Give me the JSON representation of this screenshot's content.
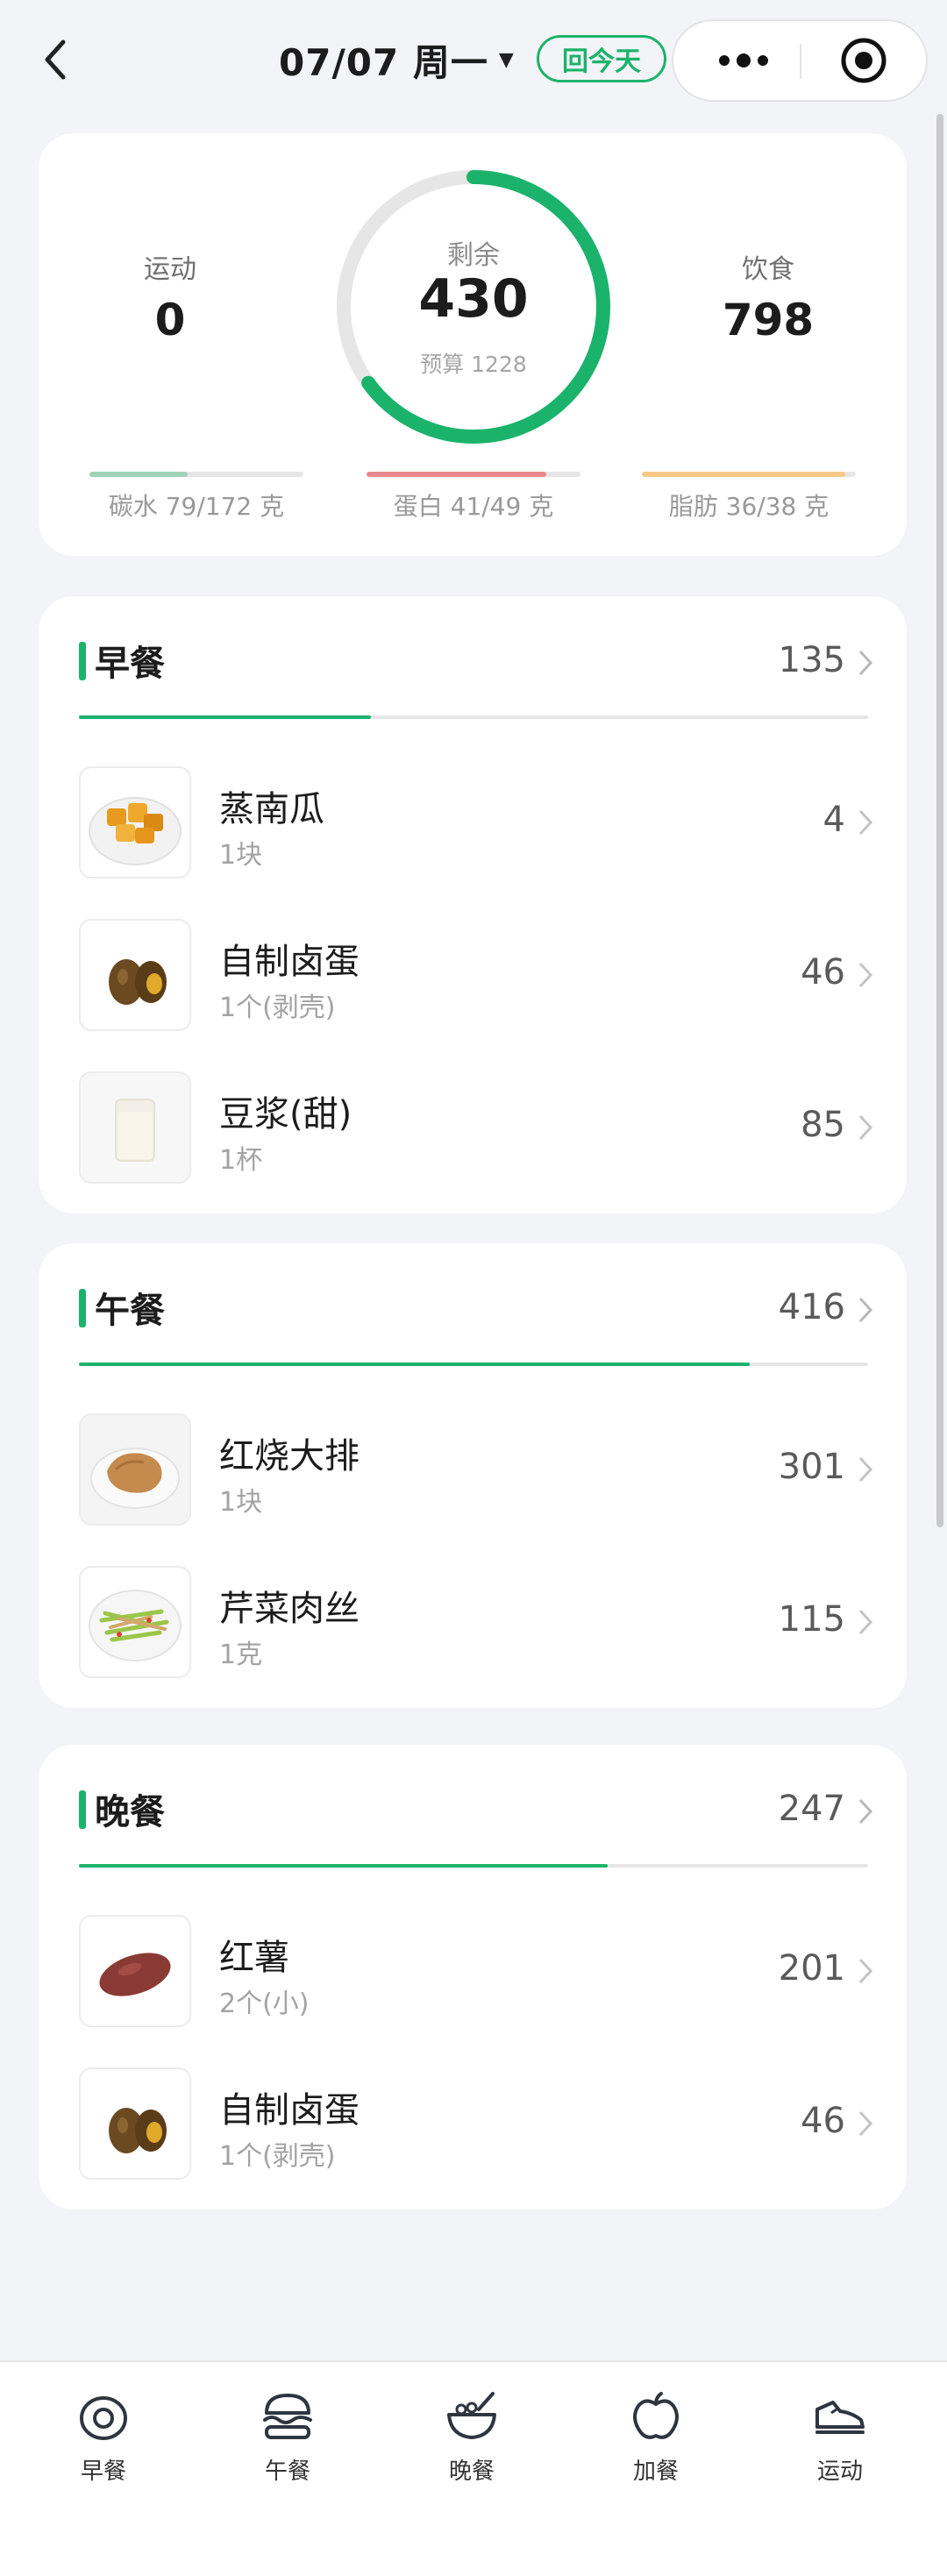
{
  "header": {
    "date": "07/07 周一",
    "dropdown_arrow": "▼",
    "today_badge": "回今天",
    "icons": {
      "back": "chevron-left-icon",
      "more": "more-dots-icon",
      "close": "target-close-icon"
    }
  },
  "summary": {
    "exercise": {
      "label": "运动",
      "value": "0"
    },
    "remaining": {
      "label": "剩余",
      "value": "430",
      "budget": "预算 1228",
      "ring_fraction": 0.65
    },
    "intake": {
      "label": "饮食",
      "value": "798"
    },
    "macros": [
      {
        "label": "碳水 79/172 克",
        "fraction": 0.46,
        "color": "#9fd2b6"
      },
      {
        "label": "蛋白 41/49 克",
        "fraction": 0.84,
        "color": "#e8888a"
      },
      {
        "label": "脂肪 36/38 克",
        "fraction": 0.95,
        "color": "#f7c889"
      }
    ]
  },
  "meals": [
    {
      "title": "早餐",
      "total": "135",
      "progress": 0.37,
      "items": [
        {
          "name": "蒸南瓜",
          "amount": "1块",
          "calories": "4",
          "icon": "steamed-pumpkin-image"
        },
        {
          "name": "自制卤蛋",
          "amount": "1个(剥壳)",
          "calories": "46",
          "icon": "braised-egg-image"
        },
        {
          "name": "豆浆(甜)",
          "amount": "1杯",
          "calories": "85",
          "icon": "soy-milk-image"
        }
      ]
    },
    {
      "title": "午餐",
      "total": "416",
      "progress": 0.85,
      "items": [
        {
          "name": "红烧大排",
          "amount": "1块",
          "calories": "301",
          "icon": "braised-pork-chop-image"
        },
        {
          "name": "芹菜肉丝",
          "amount": "1克",
          "calories": "115",
          "icon": "celery-pork-image"
        }
      ]
    },
    {
      "title": "晚餐",
      "total": "247",
      "progress": 0.67,
      "items": [
        {
          "name": "红薯",
          "amount": "2个(小)",
          "calories": "201",
          "icon": "sweet-potato-image"
        },
        {
          "name": "自制卤蛋",
          "amount": "1个(剥壳)",
          "calories": "46",
          "icon": "braised-egg-image"
        }
      ]
    }
  ],
  "tabbar": [
    {
      "label": "早餐",
      "icon": "egg-icon"
    },
    {
      "label": "午餐",
      "icon": "burger-icon"
    },
    {
      "label": "晚餐",
      "icon": "bowl-icon"
    },
    {
      "label": "加餐",
      "icon": "apple-icon"
    },
    {
      "label": "运动",
      "icon": "sneaker-icon"
    }
  ],
  "colors": {
    "accent": "#1bb36b",
    "background": "#f3f4f7"
  }
}
